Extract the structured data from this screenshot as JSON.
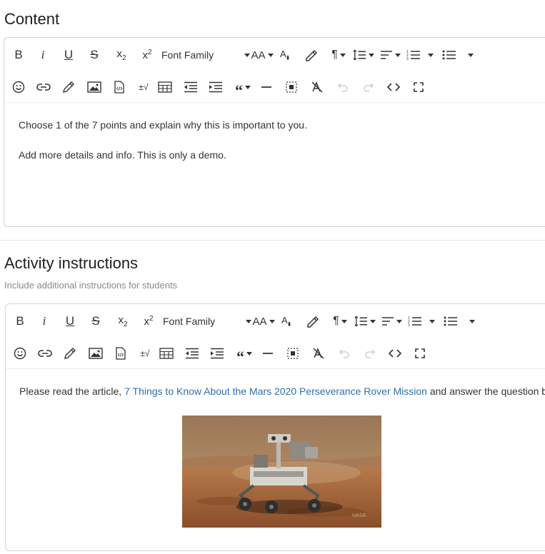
{
  "content_section": {
    "title": "Content",
    "toolbar": {
      "font_family": "Font Family",
      "font_size": "AA",
      "special_chars": "±√"
    },
    "paragraphs": [
      "Choose 1 of the 7 points and explain why this is important to you.",
      "Add more details and info. This is only a demo."
    ]
  },
  "activity_section": {
    "title": "Activity instructions",
    "subtitle": "Include additional instructions for students",
    "toolbar": {
      "font_family": "Font Family",
      "font_size": "AA",
      "special_chars": "±√"
    },
    "text_before": "Please read the article, ",
    "link_text": "7 Things to Know About the Mars 2020 Perseverance Rover Mission",
    "text_after": " and answer the question below.",
    "image": {
      "alt": "Mars rover",
      "watermark": "NASA"
    }
  },
  "colors": {
    "link": "#2d6fb0",
    "border": "#d4d4d4",
    "subtitle": "#8a8a8a",
    "disabled": "#cfcfcf"
  }
}
